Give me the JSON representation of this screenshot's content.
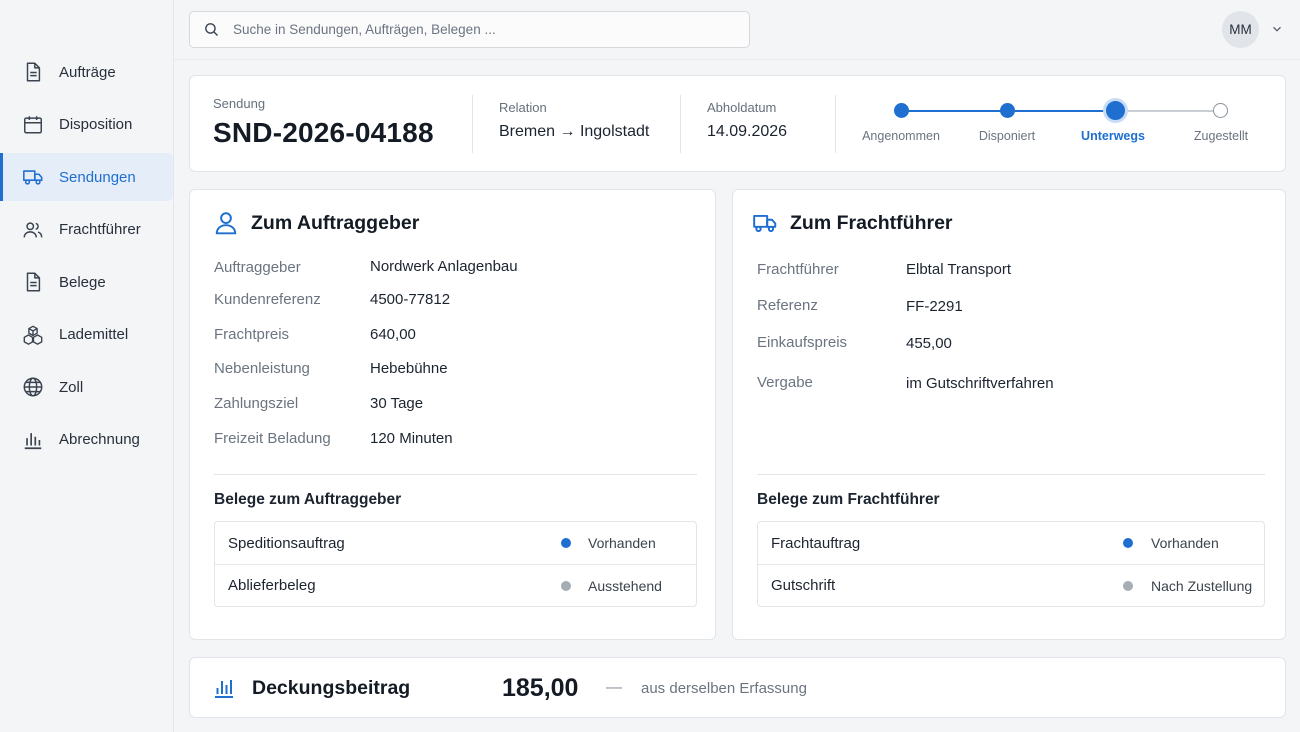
{
  "search": {
    "placeholder": "Suche in Sendungen, Aufträgen, Belegen ..."
  },
  "user": {
    "initials": "MM"
  },
  "sidebar": {
    "items": [
      {
        "label": "Aufträge",
        "icon": "document-icon",
        "active": false
      },
      {
        "label": "Disposition",
        "icon": "calendar-icon",
        "active": false
      },
      {
        "label": "Sendungen",
        "icon": "truck-icon",
        "active": true
      },
      {
        "label": "Frachtführer",
        "icon": "users-icon",
        "active": false
      },
      {
        "label": "Belege",
        "icon": "document-icon",
        "active": false
      },
      {
        "label": "Lademittel",
        "icon": "boxes-icon",
        "active": false
      },
      {
        "label": "Zoll",
        "icon": "globe-icon",
        "active": false
      },
      {
        "label": "Abrechnung",
        "icon": "bar-chart-icon",
        "active": false
      }
    ]
  },
  "shipment": {
    "label": "Sendung",
    "id": "SND-2026-04188",
    "relation_label": "Relation",
    "relation_from": "Bremen",
    "relation_arrow": "→",
    "relation_to": "Ingolstadt",
    "pickup_label": "Abholdatum",
    "pickup_date": "14.09.2026"
  },
  "progress": {
    "steps": [
      {
        "label": "Angenommen",
        "state": "done"
      },
      {
        "label": "Disponiert",
        "state": "done"
      },
      {
        "label": "Unterwegs",
        "state": "current"
      },
      {
        "label": "Zugestellt",
        "state": "todo"
      }
    ]
  },
  "client": {
    "title": "Zum Auftraggeber",
    "fields": [
      {
        "label": "Auftraggeber",
        "value": "Nordwerk Anlagenbau"
      },
      {
        "label": "Kundenreferenz",
        "value": "4500-77812"
      },
      {
        "label": "Frachtpreis",
        "value": "640,00"
      },
      {
        "label": "Nebenleistung",
        "value": "Hebebühne"
      },
      {
        "label": "Zahlungsziel",
        "value": "30 Tage"
      },
      {
        "label": "Freizeit Beladung",
        "value": "120 Minuten"
      }
    ],
    "docs_title": "Belege zum Auftraggeber",
    "docs": [
      {
        "name": "Speditionsauftrag",
        "status": "Vorhanden",
        "status_color": "#1f6fd1"
      },
      {
        "name": "Ablieferbeleg",
        "status": "Ausstehend",
        "status_color": "#a7adb5"
      }
    ]
  },
  "carrier": {
    "title": "Zum Frachtführer",
    "fields": [
      {
        "label": "Frachtführer",
        "value": "Elbtal Transport"
      },
      {
        "label": "Referenz",
        "value": "FF-2291"
      },
      {
        "label": "Einkaufspreis",
        "value": "455,00"
      },
      {
        "label": "Vergabe",
        "value": "im Gutschriftverfahren"
      }
    ],
    "docs_title": "Belege zum Frachtführer",
    "docs": [
      {
        "name": "Frachtauftrag",
        "status": "Vorhanden",
        "status_color": "#1f6fd1"
      },
      {
        "name": "Gutschrift",
        "status": "Nach Zustellung",
        "status_color": "#a7adb5"
      }
    ]
  },
  "margin": {
    "title": "Deckungsbeitrag",
    "value": "185,00",
    "dash": "—",
    "note": "aus derselben Erfassung"
  },
  "colors": {
    "accent": "#1f6fd1",
    "muted": "#a7adb5"
  }
}
